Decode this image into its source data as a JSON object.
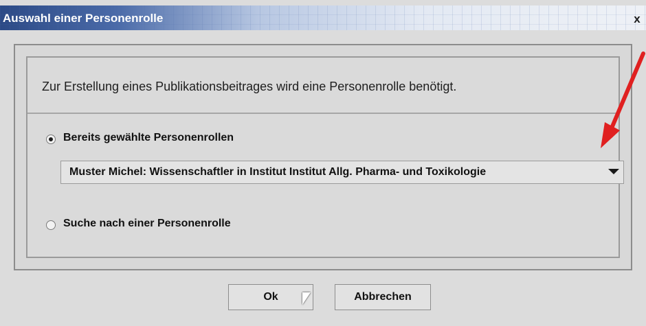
{
  "window": {
    "title": "Auswahl einer Personenrolle",
    "close_label": "x"
  },
  "dialog": {
    "intro_text": "Zur Erstellung eines Publikationsbeitrages wird eine Personenrolle benötigt.",
    "options": [
      {
        "label": "Bereits gewählte Personenrollen",
        "selected": true
      },
      {
        "label": "Suche nach einer Personenrolle",
        "selected": false
      }
    ],
    "selected_role": "Muster Michel: Wissenschaftler in Institut Institut Allg. Pharma- und Toxikologie"
  },
  "buttons": {
    "ok": "Ok",
    "cancel": "Abbrechen"
  },
  "icons": {
    "dropdown": "chevron-down-icon",
    "cursor": "mouse-pointer-icon",
    "annotation_arrow": "red-arrow-icon"
  },
  "colors": {
    "title_start": "#2c4a86",
    "title_end": "#eef1f6",
    "annotation": "#e02020"
  }
}
